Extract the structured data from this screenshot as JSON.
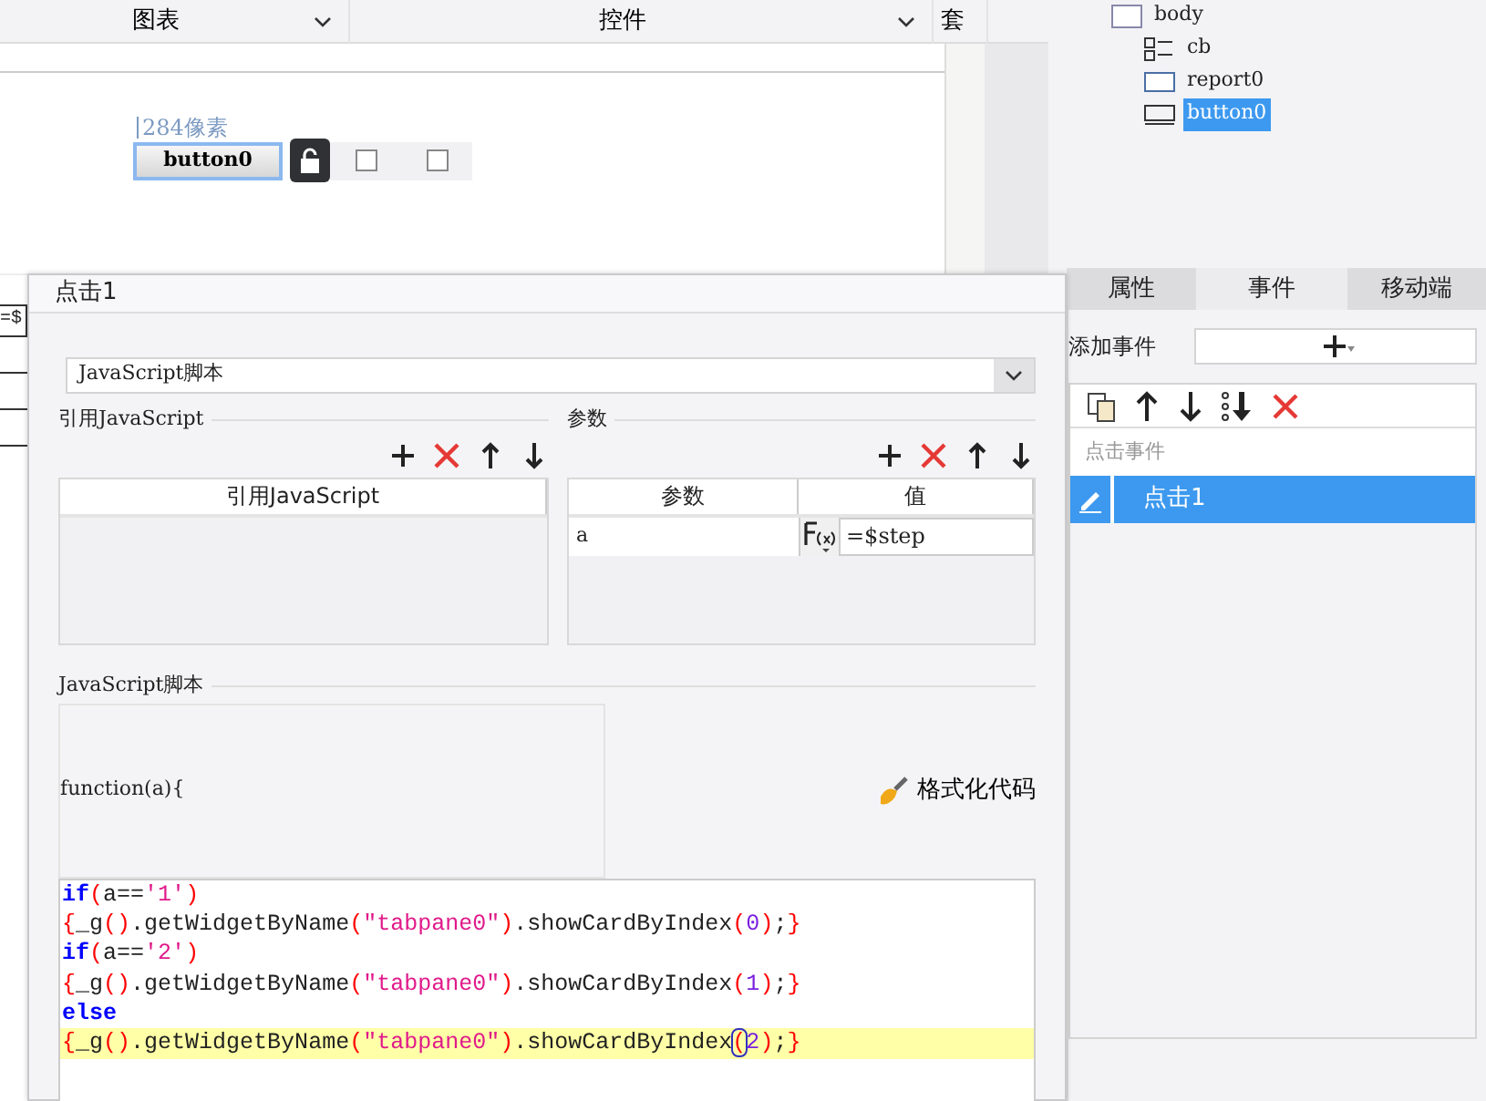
{
  "toolbar": {
    "dropdowns": [
      {
        "label": "图表"
      },
      {
        "label": "控件"
      },
      {
        "label": "套"
      }
    ]
  },
  "canvas": {
    "ruler_label": "284像素",
    "button": {
      "label": "button0",
      "selected": true
    },
    "locked": false,
    "checkboxes": [
      {
        "checked": false
      },
      {
        "checked": false
      }
    ],
    "cell_text": "=$"
  },
  "tree": {
    "items": [
      {
        "label": "body",
        "kind": "body",
        "selected": false,
        "children": [
          {
            "label": "cb",
            "kind": "checkbox",
            "selected": false
          },
          {
            "label": "report0",
            "kind": "report",
            "selected": false
          },
          {
            "label": "button0",
            "kind": "button",
            "selected": true
          }
        ]
      }
    ]
  },
  "properties_panel": {
    "tabs": [
      {
        "label": "属性",
        "selected": false
      },
      {
        "label": "事件",
        "selected": true
      },
      {
        "label": "移动端",
        "selected": false
      }
    ],
    "add_event_label": "添加事件",
    "event_list": {
      "header": "点击事件",
      "items": [
        {
          "label": "点击1",
          "selected": true
        }
      ]
    }
  },
  "dialog": {
    "title": "点击1",
    "type_select": "JavaScript脚本",
    "imports": {
      "title": "引用JavaScript",
      "columns": [
        "引用JavaScript"
      ]
    },
    "params": {
      "title": "参数",
      "columns": [
        "参数",
        "值"
      ],
      "rows": [
        {
          "name": "a",
          "value": "=$step"
        }
      ]
    },
    "script": {
      "title": "JavaScript脚本",
      "signature": "function(a){",
      "format_button": "格式化代码",
      "lines": [
        {
          "highlighted": false,
          "tokens": [
            {
              "kind": "keyword",
              "text": "if"
            },
            {
              "kind": "paren",
              "text": "("
            },
            {
              "kind": "plain",
              "text": "a=="
            },
            {
              "kind": "string",
              "text": "'1'"
            },
            {
              "kind": "paren",
              "text": ")"
            }
          ]
        },
        {
          "highlighted": false,
          "tokens": [
            {
              "kind": "paren",
              "text": "{"
            },
            {
              "kind": "plain",
              "text": "_g"
            },
            {
              "kind": "paren",
              "text": "()"
            },
            {
              "kind": "plain",
              "text": ".getWidgetByName"
            },
            {
              "kind": "paren",
              "text": "("
            },
            {
              "kind": "string",
              "text": "\"tabpane0\""
            },
            {
              "kind": "paren",
              "text": ")"
            },
            {
              "kind": "plain",
              "text": ".showCardByIndex"
            },
            {
              "kind": "paren",
              "text": "("
            },
            {
              "kind": "number",
              "text": "0"
            },
            {
              "kind": "paren",
              "text": ")"
            },
            {
              "kind": "plain",
              "text": ";"
            },
            {
              "kind": "paren",
              "text": "}"
            }
          ]
        },
        {
          "highlighted": false,
          "tokens": [
            {
              "kind": "keyword",
              "text": "if"
            },
            {
              "kind": "paren",
              "text": "("
            },
            {
              "kind": "plain",
              "text": "a=="
            },
            {
              "kind": "string",
              "text": "'2'"
            },
            {
              "kind": "paren",
              "text": ")"
            }
          ]
        },
        {
          "highlighted": false,
          "tokens": [
            {
              "kind": "paren",
              "text": "{"
            },
            {
              "kind": "plain",
              "text": "_g"
            },
            {
              "kind": "paren",
              "text": "()"
            },
            {
              "kind": "plain",
              "text": ".getWidgetByName"
            },
            {
              "kind": "paren",
              "text": "("
            },
            {
              "kind": "string",
              "text": "\"tabpane0\""
            },
            {
              "kind": "paren",
              "text": ")"
            },
            {
              "kind": "plain",
              "text": ".showCardByIndex"
            },
            {
              "kind": "paren",
              "text": "("
            },
            {
              "kind": "number",
              "text": "1"
            },
            {
              "kind": "paren",
              "text": ")"
            },
            {
              "kind": "plain",
              "text": ";"
            },
            {
              "kind": "paren",
              "text": "}"
            }
          ]
        },
        {
          "highlighted": false,
          "tokens": [
            {
              "kind": "keyword",
              "text": "else"
            }
          ]
        },
        {
          "highlighted": true,
          "tokens": [
            {
              "kind": "paren",
              "text": "{"
            },
            {
              "kind": "plain",
              "text": "_g"
            },
            {
              "kind": "paren",
              "text": "()"
            },
            {
              "kind": "plain",
              "text": ".getWidgetByName"
            },
            {
              "kind": "paren",
              "text": "("
            },
            {
              "kind": "string",
              "text": "\"tabpane0\""
            },
            {
              "kind": "paren",
              "text": ")"
            },
            {
              "kind": "plain",
              "text": ".showCardByIndex"
            },
            {
              "kind": "matched",
              "text": "("
            },
            {
              "kind": "number",
              "text": "2"
            },
            {
              "kind": "paren",
              "text": ")"
            },
            {
              "kind": "plain",
              "text": ";"
            },
            {
              "kind": "paren",
              "text": "}"
            }
          ]
        }
      ]
    }
  }
}
